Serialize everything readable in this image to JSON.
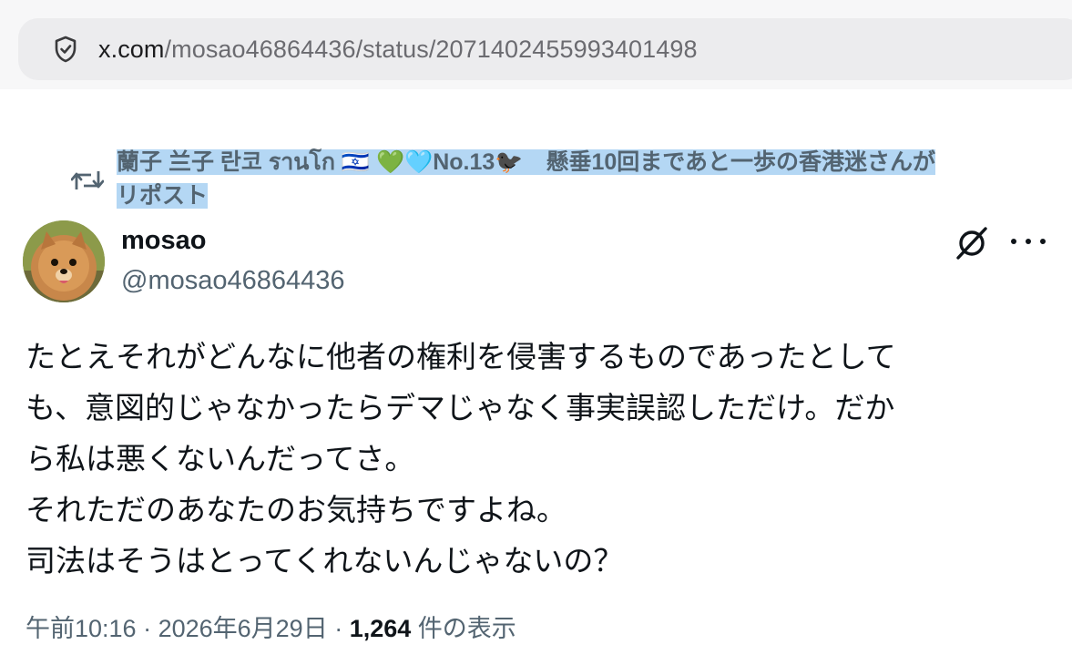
{
  "browser": {
    "url_host": "x.com",
    "url_path": "/mosao46864436/status/2071402455993401498",
    "security_icon": "shield-icon"
  },
  "repost": {
    "icon": "repost-icon",
    "line1": "蘭子 兰子 란코 รานโก 🇮🇱 💚🩵No.13🐦‍⬛　懸垂10回まであと一歩の香港迷さんが",
    "line2": "リポスト"
  },
  "author": {
    "display_name": "mosao",
    "handle": "@mosao46864436",
    "avatar": "pomeranian-dog-avatar"
  },
  "tweet": {
    "lines": [
      "たとえそれがどんなに他者の権利を侵害するものであったとして",
      "も、意図的じゃなかったらデマじゃなく事実誤認しただけ。だか",
      "ら私は悪くないんだってさ。",
      "それただのあなたのお気持ちですよね。",
      "司法はそうはとってくれないんじゃないの？"
    ]
  },
  "meta": {
    "time": "午前10:16",
    "sep1": " · ",
    "date": "2026年6月29日",
    "sep2": " · ",
    "views": "1,264",
    "views_label": " 件の表示"
  },
  "colors": {
    "accent_highlight": "#b4d7f4",
    "secondary_text": "#536471",
    "primary_text": "#0f1419"
  }
}
